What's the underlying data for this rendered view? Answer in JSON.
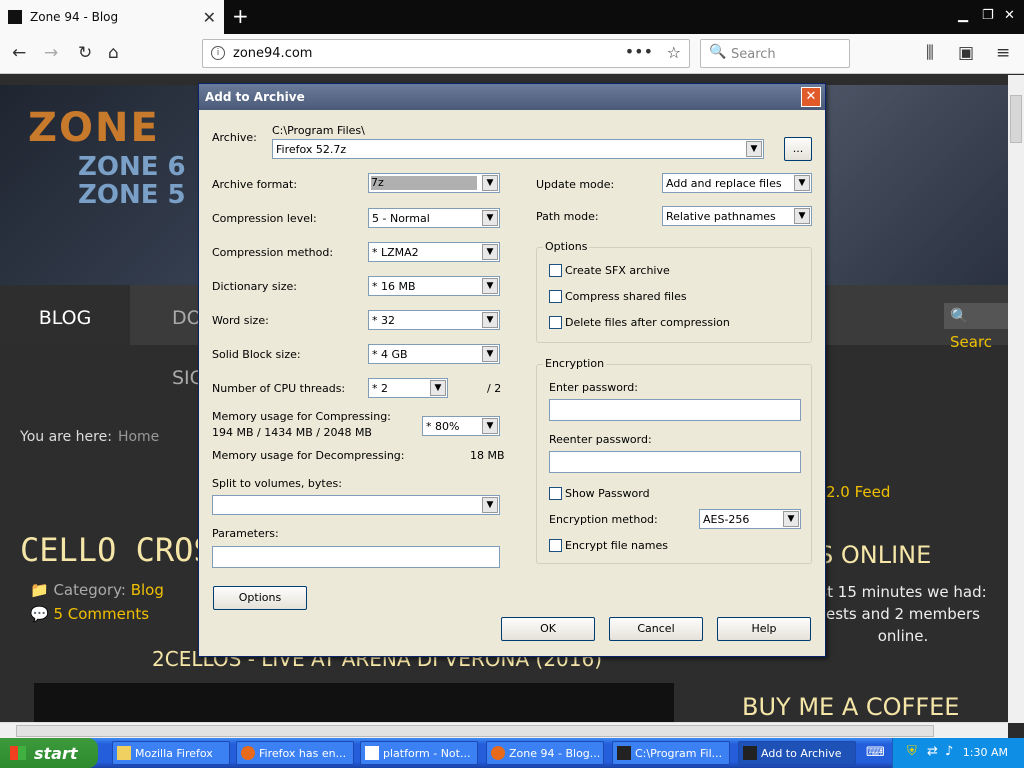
{
  "browser": {
    "tab_title": "Zone 94 - Blog",
    "url": "zone94.com",
    "search_placeholder": "Search"
  },
  "page": {
    "logo_text": "ZONE",
    "logo_sub": "ZONE 6\nZONE 5",
    "menu_blog": "BLOG",
    "menu_do": "DO",
    "menu_sig": "SIG",
    "search_button": "Searc",
    "breadcrumb_label": "You are here:",
    "breadcrumb_home": "Home",
    "post_title": "CELLO CROSS",
    "category_label": "Category:",
    "category_value": "Blog",
    "comments": "5 Comments",
    "video_title": "2CELLOS - LIVE AT ARENA DI VERONA (2016)",
    "feed": "2.0 Feed",
    "online_title": "S ONLINE",
    "online_text": "st 15 minutes we had: ests and 2 members online.",
    "coffee": "BUY ME A COFFEE"
  },
  "dialog": {
    "title": "Add to Archive",
    "archive_label": "Archive:",
    "archive_path": "C:\\Program Files\\",
    "archive_name": "Firefox 52.7z",
    "browse_label": "...",
    "archive_format_label": "Archive format:",
    "archive_format": "7z",
    "compression_level_label": "Compression level:",
    "compression_level": "5 - Normal",
    "compression_method_label": "Compression method:",
    "compression_method": "* LZMA2",
    "dictionary_size_label": "Dictionary size:",
    "dictionary_size": "* 16 MB",
    "word_size_label": "Word size:",
    "word_size": "* 32",
    "solid_block_label": "Solid Block size:",
    "solid_block": "* 4 GB",
    "cpu_threads_label": "Number of CPU threads:",
    "cpu_threads": "* 2",
    "cpu_threads_max": "/ 2",
    "mem_compress_label": "Memory usage for Compressing:",
    "mem_compress_values": "194 MB / 1434 MB / 2048 MB",
    "mem_compress_pct": "* 80%",
    "mem_decompress_label": "Memory usage for Decompressing:",
    "mem_decompress_value": "18 MB",
    "split_label": "Split to volumes, bytes:",
    "split_value": "",
    "parameters_label": "Parameters:",
    "parameters_value": "",
    "options_button": "Options",
    "update_mode_label": "Update mode:",
    "update_mode": "Add and replace files",
    "path_mode_label": "Path mode:",
    "path_mode": "Relative pathnames",
    "options_group": "Options",
    "create_sfx": "Create SFX archive",
    "compress_shared": "Compress shared files",
    "delete_after": "Delete files after compression",
    "encryption_group": "Encryption",
    "enter_password_label": "Enter password:",
    "reenter_password_label": "Reenter password:",
    "show_password": "Show Password",
    "encryption_method_label": "Encryption method:",
    "encryption_method": "AES-256",
    "encrypt_names": "Encrypt file names",
    "ok": "OK",
    "cancel": "Cancel",
    "help": "Help"
  },
  "taskbar": {
    "start": "start",
    "items": [
      "Mozilla Firefox",
      "Firefox has en...",
      "platform - Not...",
      "Zone 94 - Blog...",
      "C:\\Program Fil...",
      "Add to Archive"
    ],
    "clock": "1:30 AM"
  }
}
